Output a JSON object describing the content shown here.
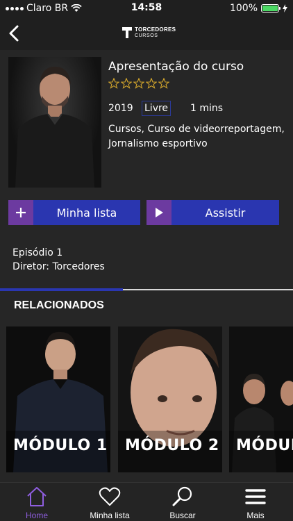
{
  "status_bar": {
    "carrier": "Claro BR",
    "time": "14:58",
    "battery": "100%",
    "battery_level": 1.0
  },
  "header": {
    "logo_line1": "TORCEDORES",
    "logo_line2": "CURSOS"
  },
  "course": {
    "title": "Apresentação do curso",
    "stars_total": 5,
    "stars_filled": 0,
    "year": "2019",
    "rating": "Livre",
    "duration": "1 mins",
    "categories": "Cursos, Curso de videorreportagem, Jornalismo esportivo",
    "episode": "Episódio 1",
    "director": "Diretor: Torcedores"
  },
  "actions": {
    "list_label": "Minha lista",
    "watch_label": "Assistir"
  },
  "related": {
    "title": "RELACIONADOS",
    "progress": 0.42,
    "items": [
      {
        "label": "MÓDULO 1"
      },
      {
        "label": "MÓDULO 2"
      },
      {
        "label": "MÓDUL"
      }
    ]
  },
  "tabs": [
    {
      "label": "Home",
      "icon": "home-icon",
      "active": true
    },
    {
      "label": "Minha lista",
      "icon": "heart-icon",
      "active": false
    },
    {
      "label": "Buscar",
      "icon": "search-icon",
      "active": false
    },
    {
      "label": "Mais",
      "icon": "menu-icon",
      "active": false
    }
  ],
  "colors": {
    "accent_purple": "#8f5ee0",
    "button_blue": "#2a36b0",
    "button_icon_purple": "#6c3aa0",
    "star_gold": "#d4a72c"
  }
}
